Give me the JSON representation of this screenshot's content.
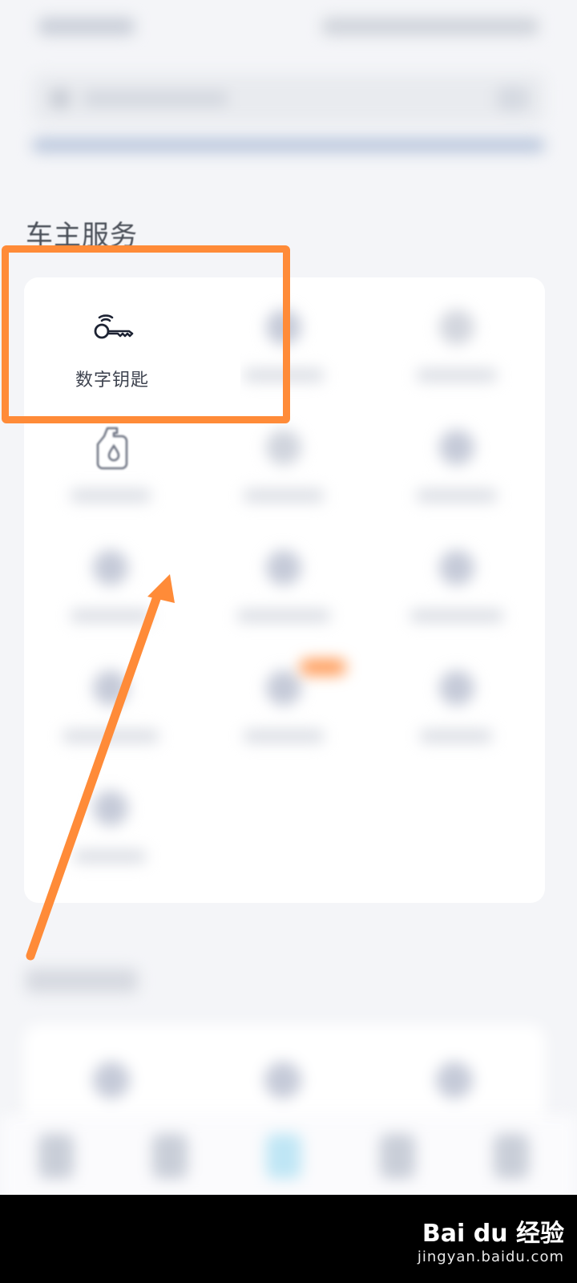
{
  "services": {
    "section_title": "车主服务",
    "featured_item": {
      "label": "数字钥匙",
      "icon": "key-icon"
    },
    "second_row_icon": "oil-bottle-icon"
  },
  "annotation": {
    "highlight_color": "#ff8b38",
    "arrow_color": "#ff8b38"
  },
  "watermark": {
    "brand": "Bai du 经验",
    "url": "jingyan.baidu.com"
  }
}
